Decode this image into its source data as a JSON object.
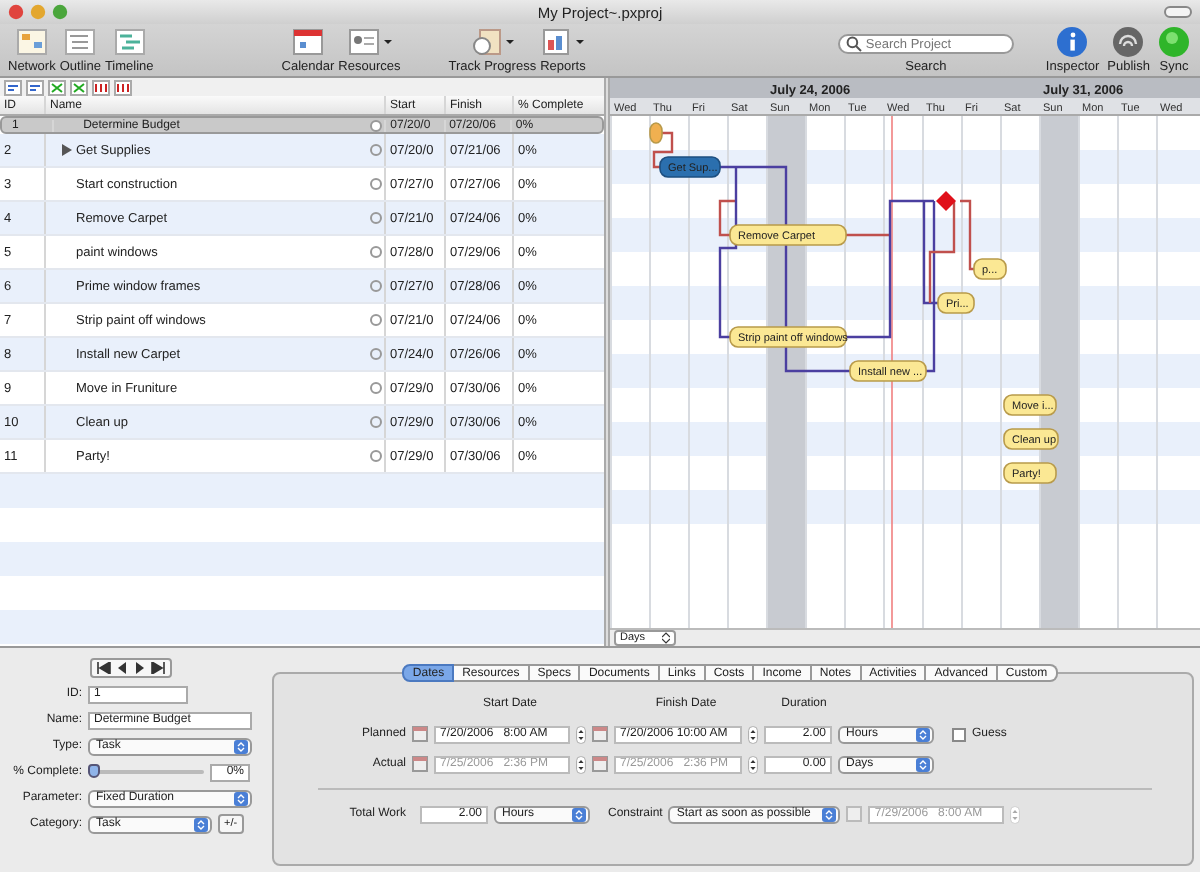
{
  "window": {
    "title": "My Project~.pxproj"
  },
  "toolbar": {
    "items": [
      {
        "label": "Network",
        "kind": "network"
      },
      {
        "label": "Outline",
        "kind": "outline"
      },
      {
        "label": "Timeline",
        "kind": "timeline"
      },
      {
        "label": "Calendar",
        "kind": "calendar"
      },
      {
        "label": "Resources",
        "kind": "resources"
      },
      {
        "label": "Track Progress",
        "kind": "progress"
      },
      {
        "label": "Reports",
        "kind": "reports"
      }
    ],
    "search": {
      "placeholder": "Search Project",
      "label": "Search"
    },
    "right_items": [
      {
        "label": "Inspector",
        "kind": "inspector"
      },
      {
        "label": "Publish",
        "kind": "publish"
      },
      {
        "label": "Sync",
        "kind": "sync"
      }
    ]
  },
  "table": {
    "columns": [
      "ID",
      "Name",
      "Start",
      "Finish",
      "% Complete"
    ],
    "rows": [
      {
        "id": "1",
        "name": "Determine Budget",
        "start": "07/20/0",
        "finish": "07/20/06",
        "complete": "0%",
        "kind": "task",
        "selected": true,
        "bar": ""
      },
      {
        "id": "2",
        "name": "Get Supplies",
        "start": "07/20/0",
        "finish": "07/21/06",
        "complete": "0%",
        "kind": "group",
        "selected": false,
        "bar": "Get Sup..."
      },
      {
        "id": "3",
        "name": "Start construction",
        "start": "07/27/0",
        "finish": "07/27/06",
        "complete": "0%",
        "kind": "milestone",
        "selected": false,
        "bar": ""
      },
      {
        "id": "4",
        "name": "Remove Carpet",
        "start": "07/21/0",
        "finish": "07/24/06",
        "complete": "0%",
        "kind": "task",
        "selected": false,
        "bar": "Remove Carpet"
      },
      {
        "id": "5",
        "name": "paint windows",
        "start": "07/28/0",
        "finish": "07/29/06",
        "complete": "0%",
        "kind": "task",
        "selected": false,
        "bar": "p..."
      },
      {
        "id": "6",
        "name": "Prime window frames",
        "start": "07/27/0",
        "finish": "07/28/06",
        "complete": "0%",
        "kind": "task",
        "selected": false,
        "bar": "Pri..."
      },
      {
        "id": "7",
        "name": "Strip paint off windows",
        "start": "07/21/0",
        "finish": "07/24/06",
        "complete": "0%",
        "kind": "task",
        "selected": false,
        "bar": "Strip paint off windows"
      },
      {
        "id": "8",
        "name": "Install new Carpet",
        "start": "07/24/0",
        "finish": "07/26/06",
        "complete": "0%",
        "kind": "task",
        "selected": false,
        "bar": "Install new ..."
      },
      {
        "id": "9",
        "name": "Move in Fruniture",
        "start": "07/29/0",
        "finish": "07/30/06",
        "complete": "0%",
        "kind": "task",
        "selected": false,
        "bar": "Move i..."
      },
      {
        "id": "10",
        "name": "Clean up",
        "start": "07/29/0",
        "finish": "07/30/06",
        "complete": "0%",
        "kind": "task",
        "selected": false,
        "bar": "Clean up"
      },
      {
        "id": "11",
        "name": "Party!",
        "start": "07/29/0",
        "finish": "07/30/06",
        "complete": "0%",
        "kind": "task",
        "selected": false,
        "bar": "Party!"
      }
    ]
  },
  "gantt": {
    "weeks": [
      "July 24, 2006",
      "July 31, 2006"
    ],
    "days": [
      {
        "label": "Wed",
        "shaded": false
      },
      {
        "label": "Thu",
        "shaded": false
      },
      {
        "label": "Fri",
        "shaded": false
      },
      {
        "label": "Sat",
        "shaded": false
      },
      {
        "label": "Sun",
        "shaded": true
      },
      {
        "label": "Mon",
        "shaded": false
      },
      {
        "label": "Tue",
        "shaded": false
      },
      {
        "label": "Wed",
        "shaded": false
      },
      {
        "label": "Thu",
        "shaded": false
      },
      {
        "label": "Fri",
        "shaded": false
      },
      {
        "label": "Sat",
        "shaded": false
      },
      {
        "label": "Sun",
        "shaded": true
      },
      {
        "label": "Mon",
        "shaded": false
      },
      {
        "label": "Tue",
        "shaded": false
      },
      {
        "label": "Wed",
        "shaded": false
      }
    ],
    "scale": "Days"
  },
  "inspector": {
    "id_label": "ID:",
    "id": "1",
    "name_label": "Name:",
    "name": "Determine Budget",
    "type_label": "Type:",
    "type": "Task",
    "complete_label": "% Complete:",
    "complete_slider": {
      "level": 0
    },
    "complete": "0%",
    "parameter_label": "Parameter:",
    "parameter": "Fixed Duration",
    "category_label": "Category:",
    "category": "Task",
    "category_button": "+/-"
  },
  "tabs": [
    {
      "label": "Dates",
      "selected": true
    },
    {
      "label": "Resources",
      "selected": false
    },
    {
      "label": "Specs",
      "selected": false
    },
    {
      "label": "Documents",
      "selected": false
    },
    {
      "label": "Links",
      "selected": false
    },
    {
      "label": "Costs",
      "selected": false
    },
    {
      "label": "Income",
      "selected": false
    },
    {
      "label": "Notes",
      "selected": false
    },
    {
      "label": "Activities",
      "selected": false
    },
    {
      "label": "Advanced",
      "selected": false
    },
    {
      "label": "Custom",
      "selected": false
    }
  ],
  "dates": {
    "headers": [
      "Start Date",
      "Finish Date",
      "Duration"
    ],
    "rows": [
      {
        "label": "Planned",
        "start": "7/20/2006   8:00 AM",
        "finish": "7/20/2006 10:00 AM",
        "duration": "2.00",
        "unit": "Hours",
        "disabled": false
      },
      {
        "label": "Actual",
        "start": "7/25/2006   2:36 PM",
        "finish": "7/25/2006   2:36 PM",
        "duration": "0.00",
        "unit": "Days",
        "disabled": true
      }
    ],
    "guess": {
      "label": "Guess",
      "checked": false
    },
    "total_work_label": "Total Work",
    "total_work": "2.00",
    "total_work_unit": "Hours",
    "constraint_label": "Constraint",
    "constraint": "Start as soon as possible",
    "constraint_date": "7/29/2006   8:00 AM"
  }
}
